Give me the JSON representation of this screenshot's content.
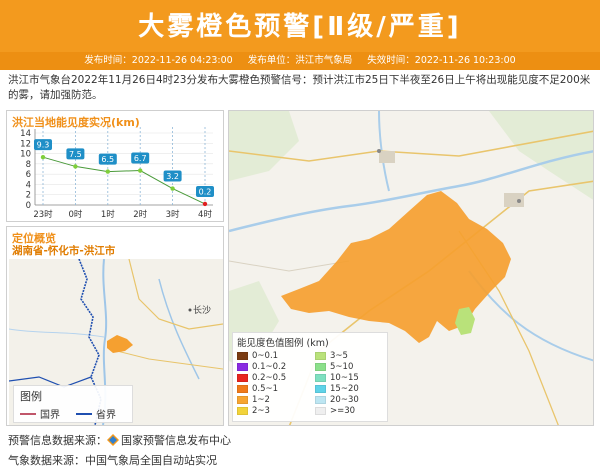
{
  "header": {
    "title": "大雾橙色预警[Ⅱ级/严重]",
    "publish_time": "发布时间：2022-11-26 04:23:00",
    "publisher": "发布单位：洪江市气象局",
    "expire_time": "失效时间：2022-11-26 10:23:00"
  },
  "notice": "洪江市气象台2022年11月26日4时23分发布大雾橙色预警信号：预计洪江市25日下半夜至26日上午将出现能见度不足200米的雾，请加强防范。",
  "visibility_panel": {
    "title": "洪江当地能见度实况(km)"
  },
  "chart_data": {
    "type": "line",
    "title": "洪江当地能见度实况(km)",
    "categories": [
      "23时",
      "0时",
      "1时",
      "2时",
      "3时",
      "4时"
    ],
    "values": [
      9.3,
      7.5,
      6.5,
      6.7,
      3.2,
      0.2
    ],
    "yticks": [
      0,
      2,
      4,
      6,
      8,
      10,
      12,
      14
    ],
    "ylim": [
      0,
      14
    ],
    "series_color": "#4a9a3a",
    "point_color_normal": "#7fcf3a",
    "point_color_last": "#e02020",
    "label_bg": "#1f8fc7"
  },
  "location_panel": {
    "title": "定位概览",
    "subtitle": "湖南省-怀化市-洪江市",
    "map_label_changsha": "长沙",
    "legend_title": "图例",
    "legend_country": "国界",
    "legend_province": "省界",
    "country_color": "#c0566a",
    "province_color": "#1f4fb0"
  },
  "main_map": {
    "legend_title": "能见度色值图例 (km)",
    "legend_items": [
      {
        "label": "0~0.1",
        "color": "#7a3b12"
      },
      {
        "label": "3~5",
        "color": "#b9e27a"
      },
      {
        "label": "0.1~0.2",
        "color": "#8a2be2"
      },
      {
        "label": "5~10",
        "color": "#8be08a"
      },
      {
        "label": "0.2~0.5",
        "color": "#e8251f"
      },
      {
        "label": "10~15",
        "color": "#7fe0c0"
      },
      {
        "label": "0.5~1",
        "color": "#f07a1a"
      },
      {
        "label": "15~20",
        "color": "#5fd3e8"
      },
      {
        "label": "1~2",
        "color": "#f7a531"
      },
      {
        "label": "20~30",
        "color": "#bde6f2"
      },
      {
        "label": "2~3",
        "color": "#f2d33a"
      },
      {
        "label": ">=30",
        "color": "#efefef"
      }
    ],
    "fog_color": "#f5a030",
    "minor_zone_color": "#b9e27a"
  },
  "footer": {
    "warning_source": "预警信息数据来源：",
    "warning_source_name": "国家预警信息发布中心",
    "weather_source": "气象数据来源：中国气象局全国自动站实况"
  }
}
